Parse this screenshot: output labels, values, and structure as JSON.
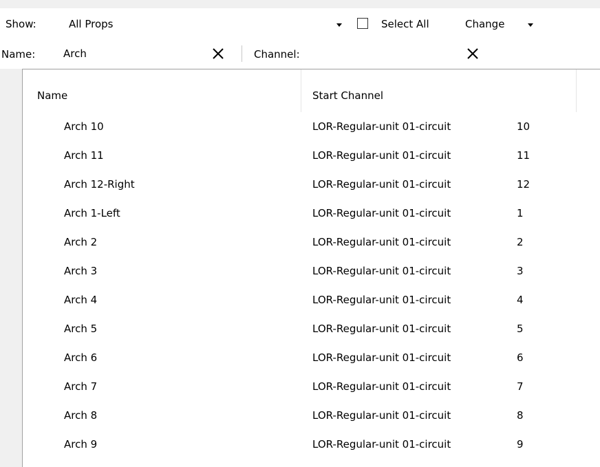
{
  "toolbar": {
    "show_label": "Show:",
    "show_value": "All Props",
    "select_all_label": "Select All",
    "select_all_checked": false,
    "change_label": "Change"
  },
  "filter": {
    "name_label": "Name:",
    "name_value": "Arch",
    "channel_label": "Channel:",
    "channel_value": ""
  },
  "list": {
    "columns": [
      "Name",
      "Start Channel"
    ],
    "rows": [
      {
        "name": "Arch 10",
        "channel_prefix": "LOR-Regular-unit 01-circuit",
        "circuit": "10"
      },
      {
        "name": "Arch 11",
        "channel_prefix": "LOR-Regular-unit 01-circuit",
        "circuit": "11"
      },
      {
        "name": "Arch 12-Right",
        "channel_prefix": "LOR-Regular-unit 01-circuit",
        "circuit": "12"
      },
      {
        "name": "Arch 1-Left",
        "channel_prefix": "LOR-Regular-unit 01-circuit",
        "circuit": "1"
      },
      {
        "name": "Arch 2",
        "channel_prefix": "LOR-Regular-unit 01-circuit",
        "circuit": "2"
      },
      {
        "name": "Arch 3",
        "channel_prefix": "LOR-Regular-unit 01-circuit",
        "circuit": "3"
      },
      {
        "name": "Arch 4",
        "channel_prefix": "LOR-Regular-unit 01-circuit",
        "circuit": "4"
      },
      {
        "name": "Arch 5",
        "channel_prefix": "LOR-Regular-unit 01-circuit",
        "circuit": "5"
      },
      {
        "name": "Arch 6",
        "channel_prefix": "LOR-Regular-unit 01-circuit",
        "circuit": "6"
      },
      {
        "name": "Arch 7",
        "channel_prefix": "LOR-Regular-unit 01-circuit",
        "circuit": "7"
      },
      {
        "name": "Arch 8",
        "channel_prefix": "LOR-Regular-unit 01-circuit",
        "circuit": "8"
      },
      {
        "name": "Arch 9",
        "channel_prefix": "LOR-Regular-unit 01-circuit",
        "circuit": "9"
      }
    ]
  },
  "icons": {
    "clear": "close-icon",
    "dropdown": "chevron-down-icon"
  }
}
